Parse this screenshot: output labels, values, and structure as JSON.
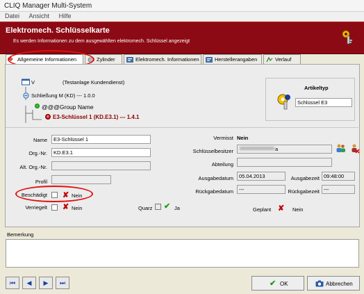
{
  "window": {
    "title": "CLIQ Manager Multi-System"
  },
  "menu": {
    "items": [
      "Datei",
      "Ansicht",
      "Hilfe"
    ]
  },
  "header": {
    "title": "Elektromech. Schlüsselkarte",
    "subtitle": "Es werden Informationen zu dem ausgewählten elektromech. Schlüssel angezeigt"
  },
  "tabs": [
    {
      "label": "Allgemeine Informationen",
      "active": true
    },
    {
      "label": "Zylinder"
    },
    {
      "label": "Elektromech. Informationen"
    },
    {
      "label": "Herstellerangaben"
    },
    {
      "label": "Verlauf"
    }
  ],
  "tree": {
    "root": "V",
    "root_suffix": "(Testanlage Kundendienst)",
    "level1": "Schließung M (KD)  --- 1.0.0",
    "level2": "@@@Group Name",
    "level3": "E3-Schlüssel 1 (KD.E3.1)  --- 1.4.1"
  },
  "article": {
    "title": "Artikeltyp",
    "value": "Schlüssel E3"
  },
  "form": {
    "name_label": "Name",
    "name_value": "E3-Schlüssel 1",
    "org_label": "Org.-Nr.",
    "org_value": "KD.E3.1",
    "alt_org_label": "Alt. Org.-Nr.",
    "alt_org_value": "",
    "profile_label": "Profil",
    "profile_value": "",
    "damaged_label": "Beschädigt",
    "damaged_value": "Nein",
    "locked_label": "Verriegelt",
    "locked_value": "Nein",
    "quartz_label": "Quarz",
    "quartz_value": "Ja"
  },
  "details": {
    "missing_label": "Vermisst",
    "missing_value": "Nein",
    "owner_label": "Schlüsselbesitzer",
    "owner_value": "a",
    "department_label": "Abteilung",
    "department_value": "",
    "issue_date_label": "Ausgabedatum",
    "issue_date_value": "05.04.2013",
    "issue_time_label": "Ausgabezeit",
    "issue_time_value": "09:48:00",
    "return_date_label": "Rückgabedatum",
    "return_date_value": "---",
    "return_time_label": "Rückgabezeit",
    "return_time_value": "---",
    "planned_label": "Geplant",
    "planned_value": "Nein"
  },
  "remarks": {
    "label": "Bemerkung",
    "value": ""
  },
  "footer": {
    "ok_label": "OK",
    "cancel_label": "Abbrechen"
  },
  "colors": {
    "header": "#8b0a14",
    "accent_red": "#e01010",
    "tree_selected": "#8b0000"
  }
}
